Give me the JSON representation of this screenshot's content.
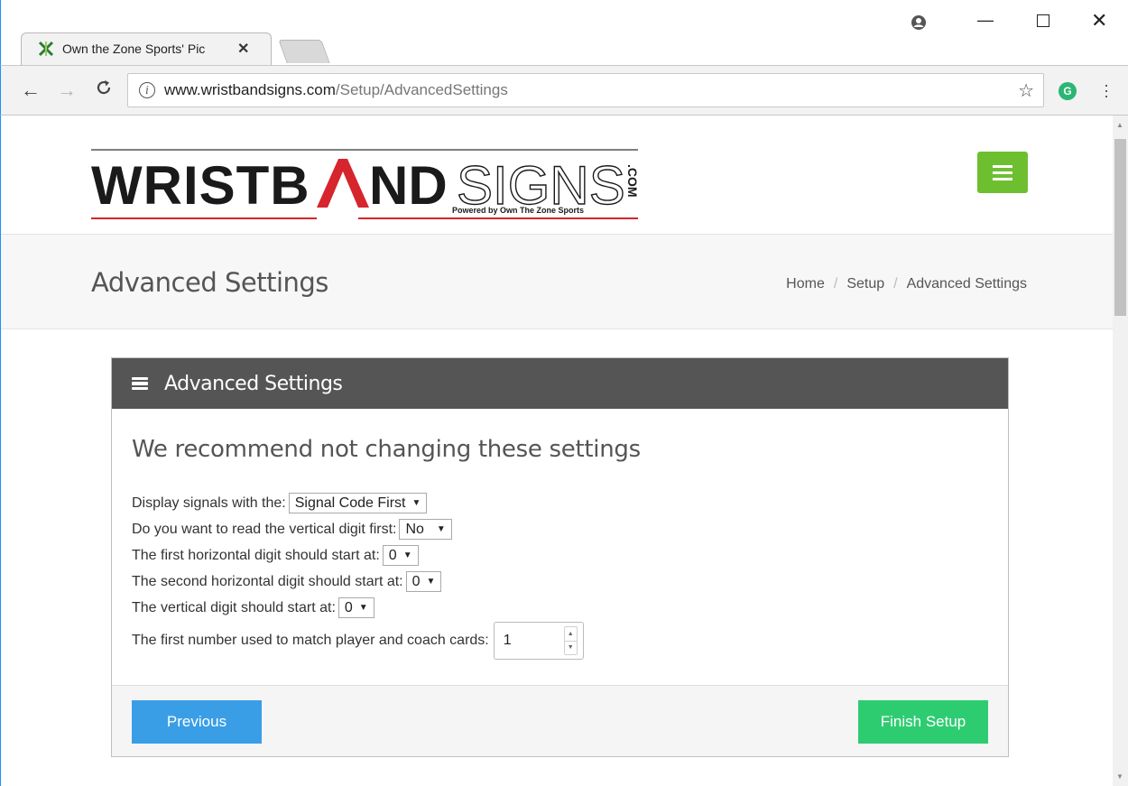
{
  "browser": {
    "tab_title": "Own the Zone Sports' Pic",
    "url_domain": "www.wristbandsigns.com",
    "url_path": "/Setup/AdvancedSettings",
    "icons": {
      "back": "arrow-left-icon",
      "forward": "arrow-right-icon",
      "reload": "reload-icon",
      "info": "info-icon",
      "star": "star-icon",
      "extension": "extension-icon",
      "menu": "menu-icon",
      "account": "account-icon",
      "minimize": "minimize-icon",
      "maximize": "maximize-icon",
      "close": "close-icon"
    }
  },
  "header": {
    "logo": {
      "main_dark": "WRISTB",
      "main_a": "A",
      "main_dark2": "ND",
      "main_outline": "SIGNS",
      "dotcom": ".COM",
      "tagline": "Powered by Own The Zone Sports"
    },
    "menu_color": "#6dbf30"
  },
  "title_band": {
    "title": "Advanced Settings",
    "breadcrumb": [
      "Home",
      "Setup",
      "Advanced Settings"
    ]
  },
  "panel": {
    "heading": "Advanced Settings",
    "recommend": "We recommend not changing these settings",
    "settings": [
      {
        "label": "Display signals with the:",
        "value": "Signal Code First"
      },
      {
        "label": "Do you want to read the vertical digit first:",
        "value": "No"
      },
      {
        "label": "The first horizontal digit should start at:",
        "value": "0"
      },
      {
        "label": "The second horizontal digit should start at:",
        "value": "0"
      },
      {
        "label": "The vertical digit should start at:",
        "value": "0"
      }
    ],
    "number_setting": {
      "label": "The first number used to match player and coach cards:",
      "value": "1"
    },
    "previous_label": "Previous",
    "finish_label": "Finish Setup"
  },
  "colors": {
    "panel_header": "#555555",
    "previous_button": "#3a9ee6",
    "finish_button": "#2ecc71",
    "logo_red": "#d6252c"
  }
}
